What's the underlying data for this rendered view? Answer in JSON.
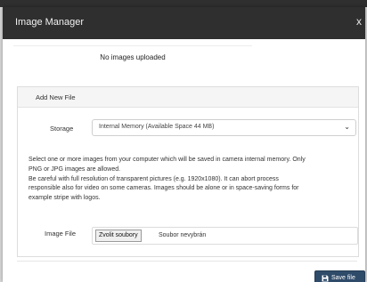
{
  "modal": {
    "title": "Image Manager",
    "close_glyph": "x"
  },
  "gallery": {
    "empty_message": "No images uploaded"
  },
  "add_file": {
    "heading": "Add New File",
    "storage_label": "Storage",
    "storage_value": "Internal Memory (Available Space 44 MB)",
    "help_lines": [
      "Select one or more images from your computer which will be saved in camera internal memory. Only",
      "PNG or JPG images are allowed.",
      "Be careful with full resolution of transparent pictures (e.g. 1920x1080). It can abort process",
      "responsible also for video on some cameras. Images should be alone or in space-saving forms for",
      "example stripe with logos."
    ],
    "image_file_label": "Image File",
    "choose_button": "Zvolit soubory",
    "no_file_text": "Soubor nevybrán"
  },
  "footer": {
    "save_label": "Save file"
  },
  "icons": {
    "close": "close-icon",
    "select_arrow": "chevron-down-icon",
    "save": "floppy-disk-icon"
  },
  "colors": {
    "header_bg": "#2f2f2f",
    "save_button_bg": "#2f4b6a",
    "panel_heading_bg": "#f5f5f5"
  }
}
